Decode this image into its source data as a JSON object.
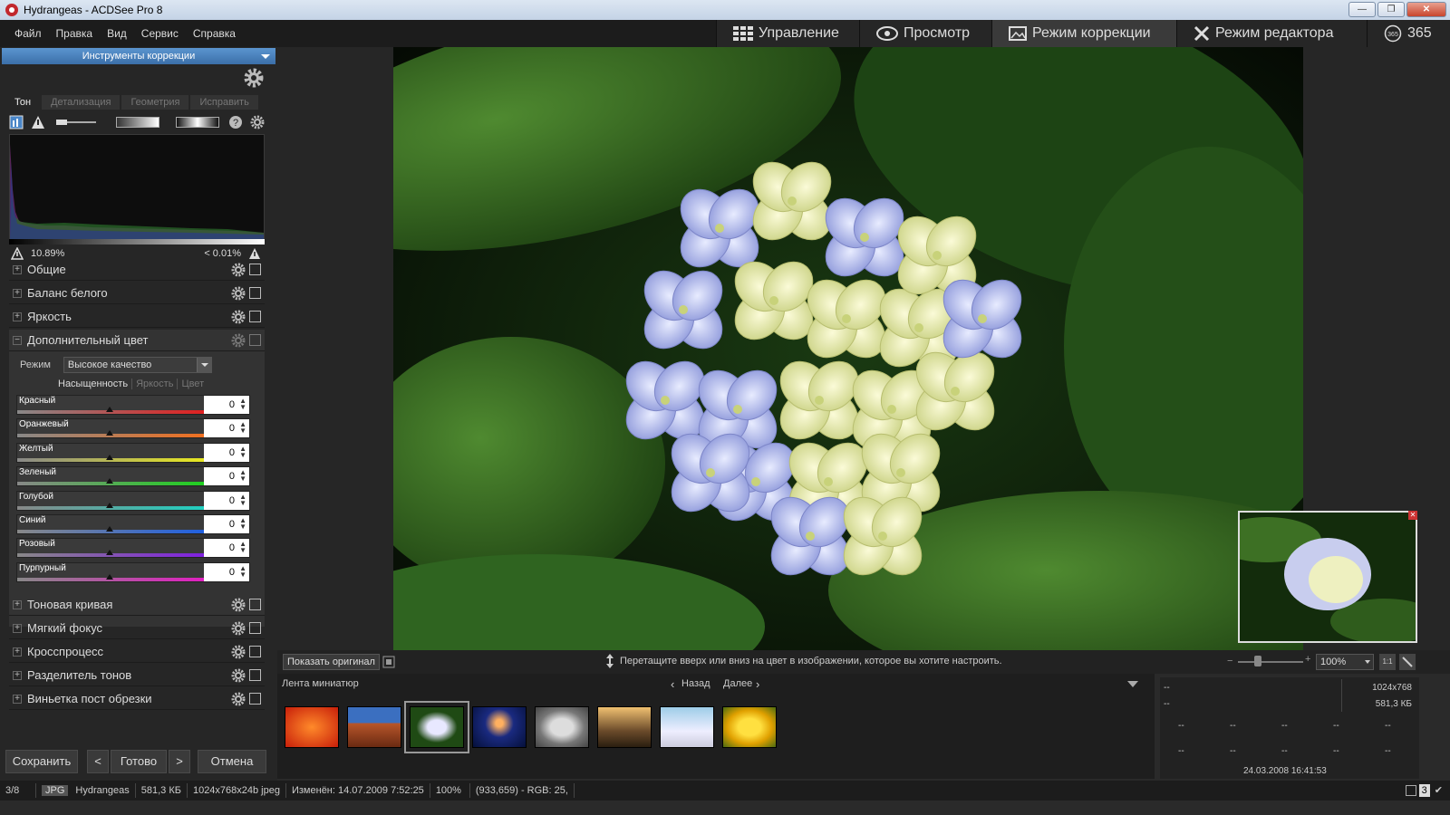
{
  "window": {
    "title": "Hydrangeas - ACDSee Pro 8",
    "minimize": "—",
    "restore": "❐",
    "close": "✕"
  },
  "menu": [
    "Файл",
    "Правка",
    "Вид",
    "Сервис",
    "Справка"
  ],
  "modes": [
    {
      "label": "Управление",
      "icon": "grid-icon"
    },
    {
      "label": "Просмотр",
      "icon": "eye-icon"
    },
    {
      "label": "Режим коррекции",
      "icon": "image-icon",
      "active": true
    },
    {
      "label": "Режим редактора",
      "icon": "tools-icon"
    },
    {
      "label": "365",
      "icon": "cloud-365-icon"
    }
  ],
  "panel": {
    "title": "Инструменты коррекции",
    "tabs": [
      "Тон",
      "Детализация",
      "Геометрия",
      "Исправить"
    ],
    "clip_low": "10.89%",
    "clip_high": "< 0.01%",
    "sections_top": [
      "Общие",
      "Баланс белого",
      "Яркость",
      "Дополнительный цвет"
    ],
    "expanded": {
      "mode_label": "Режим",
      "mode_value": "Высокое качество",
      "subtabs": [
        "Насыщенность",
        "Яркость",
        "Цвет"
      ],
      "sliders": [
        {
          "name": "Красный",
          "value": "0",
          "color": "#e02020"
        },
        {
          "name": "Оранжевый",
          "value": "0",
          "color": "#f07020"
        },
        {
          "name": "Желтый",
          "value": "0",
          "color": "#e8e820"
        },
        {
          "name": "Зеленый",
          "value": "0",
          "color": "#20d020"
        },
        {
          "name": "Голубой",
          "value": "0",
          "color": "#20d0c0"
        },
        {
          "name": "Синий",
          "value": "0",
          "color": "#2060e0"
        },
        {
          "name": "Розовый",
          "value": "0",
          "color": "#8020e0"
        },
        {
          "name": "Пурпурный",
          "value": "0",
          "color": "#e020c0"
        }
      ]
    },
    "sections_bottom": [
      "Тоновая кривая",
      "Мягкий фокус",
      "Кросспроцесс",
      "Разделитель тонов",
      "Виньетка пост обрезки"
    ],
    "buttons": {
      "save": "Сохранить",
      "prev": "<",
      "done": "Готово",
      "next": ">",
      "cancel": "Отмена"
    }
  },
  "infobar": {
    "show_original": "Показать оригинал",
    "hint": "Перетащите вверх или вниз на цвет в изображении, которое вы хотите настроить.",
    "zoom": "100%"
  },
  "filmstrip": {
    "title": "Лента миниатюр",
    "back": "Назад",
    "next": "Далее"
  },
  "properties": {
    "dim": "1024x768",
    "size": "581,3 КБ",
    "dash": "--",
    "date": "24.03.2008 16:41:53"
  },
  "status": {
    "index": "3/8",
    "format": "JPG",
    "name": "Hydrangeas",
    "size": "581,3 КБ",
    "dims": "1024x768x24b jpeg",
    "modified": "Изменён: 14.07.2009 7:52:25",
    "zoom": "100%",
    "pixel": "(933,659) - RGB: 25,",
    "count": "3"
  }
}
